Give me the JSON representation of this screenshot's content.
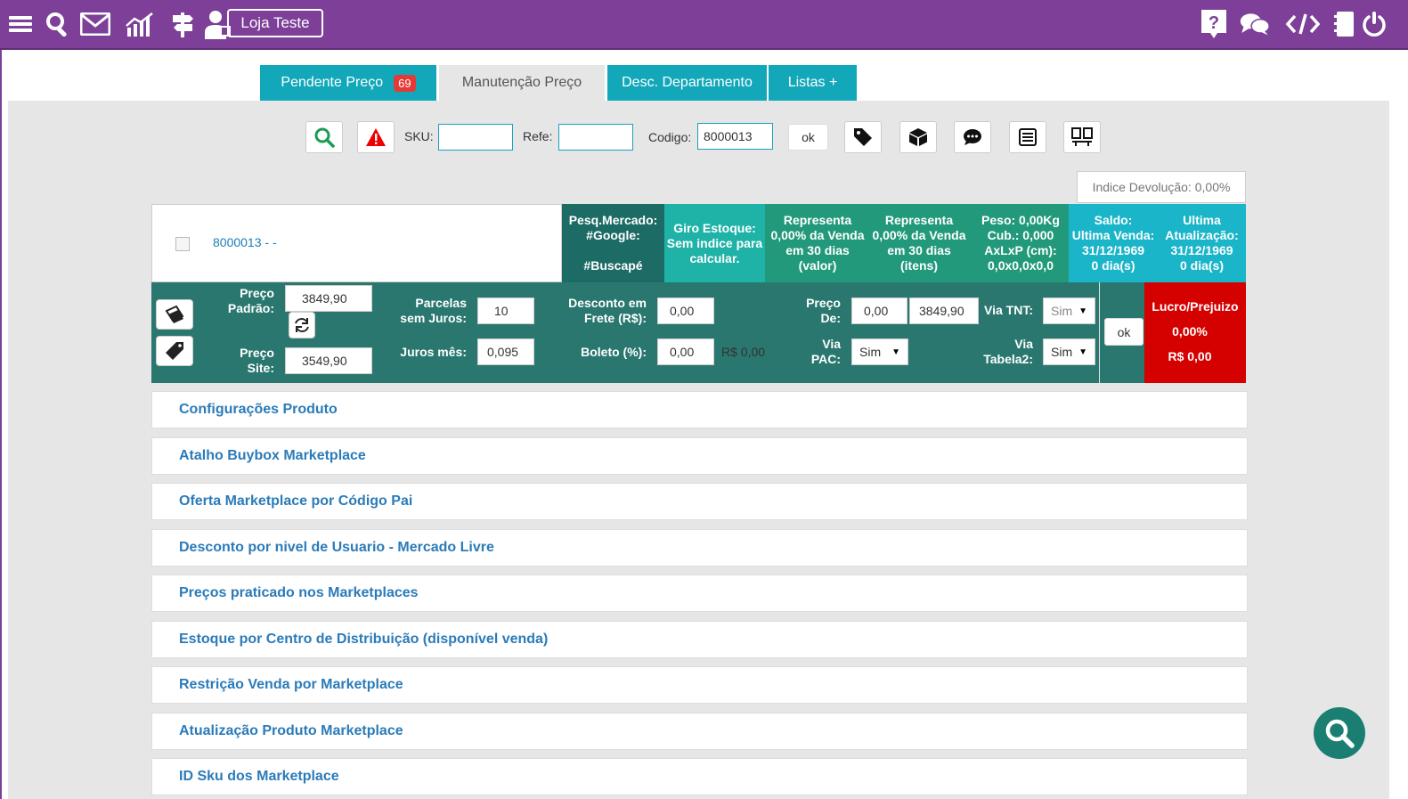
{
  "header": {
    "store_button": "Loja Teste",
    "left_icons": [
      "menu-icon",
      "search-icon",
      "mail-icon",
      "chart-icon",
      "signpost-icon",
      "user-icon"
    ],
    "right_icons": [
      "help-icon",
      "chat-icon",
      "code-icon",
      "notebook-icon",
      "power-icon"
    ]
  },
  "tabs": [
    {
      "label": "Pendente Preço",
      "badge": "69"
    },
    {
      "label": "Manutenção Preço"
    },
    {
      "label": "Desc. Departamento"
    },
    {
      "label": "Listas +"
    }
  ],
  "search": {
    "sku_label": "SKU:",
    "sku_value": "",
    "refe_label": "Refe:",
    "refe_value": "",
    "codigo_label": "Codigo:",
    "codigo_value": "8000013",
    "ok_label": "ok"
  },
  "indice_devolucao": "Indice Devolução: 0,00%",
  "product": {
    "code": "8000013 - -"
  },
  "info": {
    "pesq_mercado": [
      "Pesq.Mercado:",
      "#Google:",
      "",
      "#Buscapé"
    ],
    "giro_estoque": [
      "Giro Estoque:",
      "Sem indice para",
      "calcular."
    ],
    "representa_valor": [
      "Representa",
      "0,00% da Venda",
      "em 30 dias",
      "(valor)"
    ],
    "representa_itens": [
      "Representa",
      "0,00% da Venda",
      "em 30 dias",
      "(itens)"
    ],
    "peso": [
      "Peso: 0,00Kg",
      "Cub.: 0,000",
      "AxLxP (cm):",
      "0,0x0,0x0,0"
    ],
    "saldo": [
      "Saldo:",
      "Ultima Venda:",
      "31/12/1969",
      "0 dia(s)"
    ],
    "ultima_atualizacao": [
      "Ultima",
      "Atualização:",
      "31/12/1969",
      "0 dia(s)"
    ]
  },
  "price": {
    "preco_padrao_label": [
      "Preço",
      "Padrão:"
    ],
    "preco_padrao": "3849,90",
    "preco_site_label": [
      "Preço",
      "Site:"
    ],
    "preco_site": "3549,90",
    "parcelas_label": [
      "Parcelas",
      "sem Juros:"
    ],
    "parcelas": "10",
    "juros_label": "Juros mês:",
    "juros": "0,095",
    "desconto_frete_label": [
      "Desconto em",
      "Frete (R$):"
    ],
    "desconto_frete": "0,00",
    "boleto_label": "Boleto (%):",
    "boleto": "0,00",
    "boleto_rs": "R$ 0,00",
    "preco_de_label": [
      "Preço",
      "De:"
    ],
    "preco_de_1": "0,00",
    "preco_de_2": "3849,90",
    "via_tnt_label": "Via TNT:",
    "via_tnt": "Sim",
    "via_pac_label": [
      "Via",
      "PAC:"
    ],
    "via_pac": "Sim",
    "via_tabela2_label": [
      "Via",
      "Tabela2:"
    ],
    "via_tabela2": "Sim",
    "ok_label": "ok"
  },
  "lucro": {
    "title": "Lucro/Prejuizo",
    "percent": "0,00%",
    "value": "R$ 0,00"
  },
  "accordion": [
    "Configurações Produto",
    "Atalho Buybox Marketplace",
    "Oferta Marketplace por Código Pai",
    "Desconto por nivel de Usuario - Mercado Livre",
    "Preços praticado nos Marketplaces",
    "Estoque por Centro de Distribuição (disponível venda)",
    "Restrição Venda por Marketplace",
    "Atualização Produto Marketplace",
    "ID Sku dos Marketplace"
  ],
  "colors": {
    "header": "#7d3f98",
    "tab_active": "#12a8ba",
    "panel": "#29776f",
    "lucro": "#d50000",
    "link": "#2b7bb9"
  }
}
